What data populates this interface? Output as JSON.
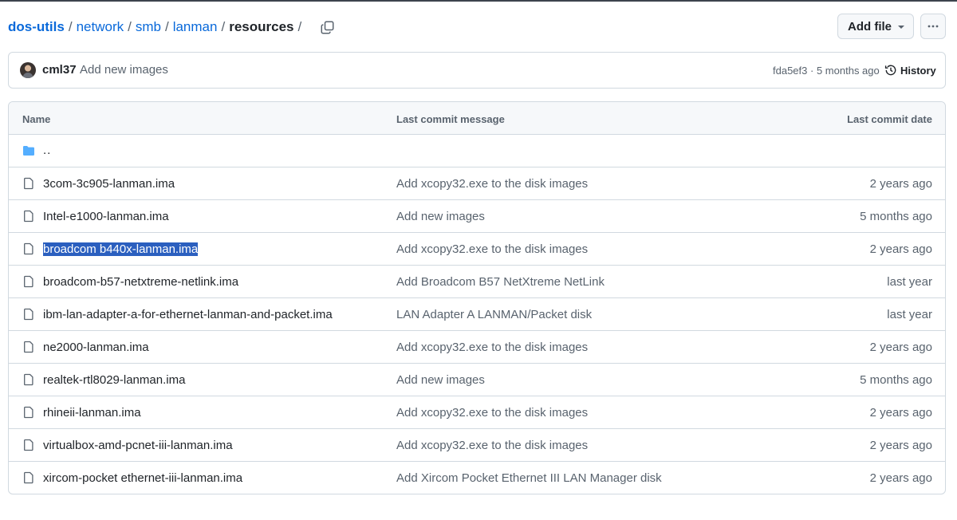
{
  "breadcrumb": {
    "repo": "dos-utils",
    "segments": [
      "network",
      "smb",
      "lanman"
    ],
    "current": "resources",
    "trailing_sep": "/"
  },
  "actions": {
    "add_file_label": "Add file",
    "more_icon": "kebab-horizontal-icon",
    "copy_icon": "copy-icon"
  },
  "latest_commit": {
    "author": "cml37",
    "message": "Add new images",
    "sha": "fda5ef3",
    "separator": "·",
    "when": "5 months ago",
    "history_label": "History"
  },
  "table": {
    "headers": {
      "name": "Name",
      "message": "Last commit message",
      "date": "Last commit date"
    },
    "parent_link": "..",
    "files": [
      {
        "name": "3com-3c905-lanman.ima",
        "message": "Add xcopy32.exe to the disk images",
        "date": "2 years ago",
        "selected": false
      },
      {
        "name": "Intel-e1000-lanman.ima",
        "message": "Add new images",
        "date": "5 months ago",
        "selected": false
      },
      {
        "name": "broadcom b440x-lanman.ima",
        "message": "Add xcopy32.exe to the disk images",
        "date": "2 years ago",
        "selected": true
      },
      {
        "name": "broadcom-b57-netxtreme-netlink.ima",
        "message": "Add Broadcom B57 NetXtreme NetLink",
        "date": "last year",
        "selected": false
      },
      {
        "name": "ibm-lan-adapter-a-for-ethernet-lanman-and-packet.ima",
        "message": "LAN Adapter A LANMAN/Packet disk",
        "date": "last year",
        "selected": false
      },
      {
        "name": "ne2000-lanman.ima",
        "message": "Add xcopy32.exe to the disk images",
        "date": "2 years ago",
        "selected": false
      },
      {
        "name": "realtek-rtl8029-lanman.ima",
        "message": "Add new images",
        "date": "5 months ago",
        "selected": false
      },
      {
        "name": "rhineii-lanman.ima",
        "message": "Add xcopy32.exe to the disk images",
        "date": "2 years ago",
        "selected": false
      },
      {
        "name": "virtualbox-amd-pcnet-iii-lanman.ima",
        "message": "Add xcopy32.exe to the disk images",
        "date": "2 years ago",
        "selected": false
      },
      {
        "name": "xircom-pocket ethernet-iii-lanman.ima",
        "message": "Add Xircom Pocket Ethernet III LAN Manager disk",
        "date": "2 years ago",
        "selected": false
      }
    ]
  },
  "colors": {
    "link": "#0969da",
    "muted": "#59636e",
    "border": "#d1d9e0",
    "folder": "#54aeff",
    "selection": "#2b5fbf"
  }
}
